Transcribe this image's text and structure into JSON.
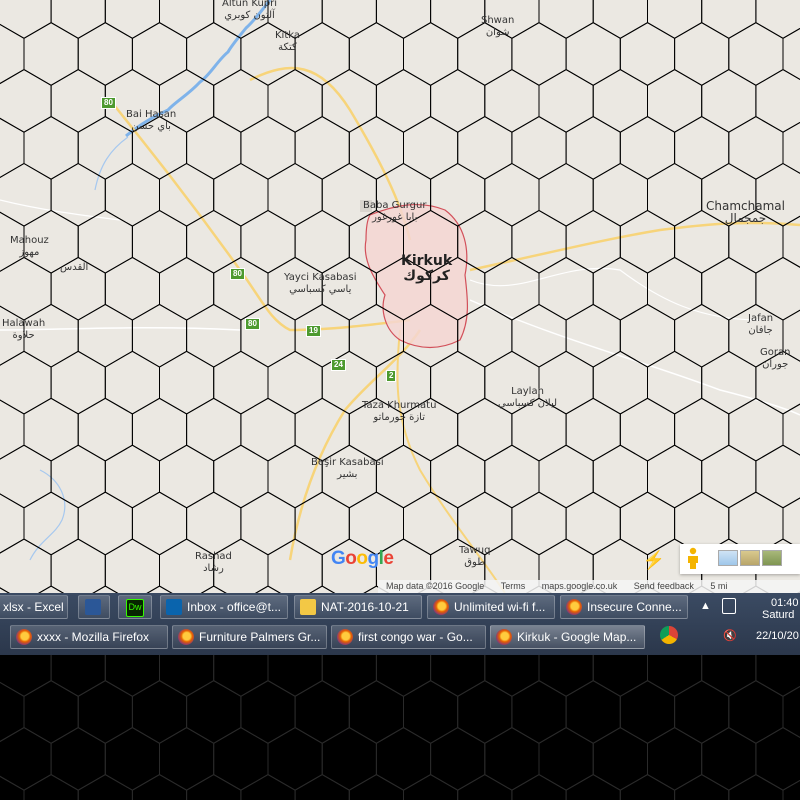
{
  "map": {
    "places": [
      {
        "id": "altun-kupri",
        "name": "Altun Kupri",
        "native": "آلتون كوبري"
      },
      {
        "id": "kitka",
        "name": "Kitka",
        "native": "كتكة"
      },
      {
        "id": "shwan",
        "name": "Shwan",
        "native": "شوان"
      },
      {
        "id": "bai-hasan",
        "name": "Bai Hasan",
        "native": "باي حسن"
      },
      {
        "id": "baba-gurgur",
        "name": "Baba Gurgur",
        "native": "بابا غورغور"
      },
      {
        "id": "chamchamal",
        "name": "Chamchamal",
        "native": "جمجمال"
      },
      {
        "id": "mahouz",
        "name": "Mahouz",
        "native": "مهوز"
      },
      {
        "id": "alquds",
        "name": "",
        "native": "القدس"
      },
      {
        "id": "kirkuk",
        "name": "Kirkuk",
        "native": "كركوك"
      },
      {
        "id": "yayci-kasabasi",
        "name": "Yayci Kasabasi",
        "native": "ياسي كسباسي"
      },
      {
        "id": "halawah",
        "name": "Halawah",
        "native": "حلاوة"
      },
      {
        "id": "jafan",
        "name": "Jafan",
        "native": "جافان"
      },
      {
        "id": "goran",
        "name": "Goran",
        "native": "جوران"
      },
      {
        "id": "laylan",
        "name": "Laylan",
        "native": "ليلان كسباسي"
      },
      {
        "id": "taza-khurmatu",
        "name": "Taza Khurmatu",
        "native": "تازة خورماتو"
      },
      {
        "id": "besir-kasabasi",
        "name": "Beşir Kasabasi",
        "native": "بشير"
      },
      {
        "id": "rashad",
        "name": "Rashad",
        "native": "رشاد"
      },
      {
        "id": "tawuq",
        "name": "Tawuq",
        "native": "طوق"
      }
    ],
    "shields": [
      {
        "id": "r80a",
        "label": "80"
      },
      {
        "id": "r80b",
        "label": "80"
      },
      {
        "id": "r80c",
        "label": "80"
      },
      {
        "id": "r19",
        "label": "19"
      },
      {
        "id": "r24",
        "label": "24"
      },
      {
        "id": "r2",
        "label": "2"
      }
    ],
    "logo": "Google",
    "attribution": {
      "map_data": "Map data ©2016 Google",
      "terms": "Terms",
      "domain": "maps.google.co.uk",
      "feedback": "Send feedback",
      "scale": "5 mi"
    },
    "colors": {
      "land": "#ebe8e2",
      "road": "#f7d47a",
      "water": "#7fb3ea",
      "city_fill": "#f5d6d2",
      "city_border": "#d2505a",
      "hex": "#000000"
    }
  },
  "taskbar": {
    "row1": [
      {
        "id": "excel",
        "label": "xlsx - Excel",
        "icon": "excel-icon"
      },
      {
        "id": "word",
        "label": "",
        "icon": "word-icon"
      },
      {
        "id": "dreamweaver",
        "label": "",
        "icon": "dreamweaver-icon"
      },
      {
        "id": "outlook",
        "label": "Inbox - office@t...",
        "icon": "outlook-icon"
      },
      {
        "id": "folder",
        "label": "NAT-2016-10-21",
        "icon": "folder-icon"
      },
      {
        "id": "ff-wifi",
        "label": "Unlimited wi-fi f...",
        "icon": "firefox-icon"
      },
      {
        "id": "ff-insecure",
        "label": "Insecure Conne...",
        "icon": "firefox-icon"
      }
    ],
    "row2": [
      {
        "id": "ff-xxxx",
        "label": "xxxx - Mozilla Firefox",
        "icon": "firefox-icon"
      },
      {
        "id": "ff-furniture",
        "label": "Furniture Palmers Gr...",
        "icon": "firefox-icon"
      },
      {
        "id": "ff-congo",
        "label": "first congo war - Go...",
        "icon": "firefox-icon"
      },
      {
        "id": "ff-kirkuk",
        "label": "Kirkuk - Google Map...",
        "icon": "firefox-icon"
      }
    ],
    "tray": {
      "time": "01:40",
      "day": "Saturd",
      "date": "22/10/20"
    }
  }
}
